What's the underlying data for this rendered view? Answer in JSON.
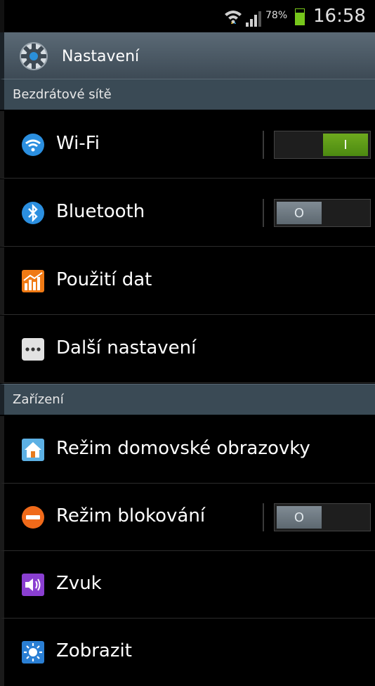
{
  "status_bar": {
    "battery_percent": "78%",
    "time": "16:58",
    "wifi_icon": "wifi-icon",
    "signal_icon": "signal-icon",
    "battery_level": 0.78
  },
  "header": {
    "title": "Nastavení",
    "icon": "gear-icon"
  },
  "sections": {
    "wireless": "Bezdrátové sítě",
    "device": "Zařízení"
  },
  "items": {
    "wifi": {
      "label": "Wi-Fi",
      "icon": "wifi-icon",
      "toggle": "on",
      "toggle_symbol": "I"
    },
    "bluetooth": {
      "label": "Bluetooth",
      "icon": "bluetooth-icon",
      "toggle": "off",
      "toggle_symbol": "O"
    },
    "data_usage": {
      "label": "Použití dat",
      "icon": "data-usage-icon"
    },
    "more_settings": {
      "label": "Další nastavení",
      "icon": "more-icon"
    },
    "home_screen_mode": {
      "label": "Režim domovské obrazovky",
      "icon": "home-icon"
    },
    "blocking_mode": {
      "label": "Režim blokování",
      "icon": "block-icon",
      "toggle": "off",
      "toggle_symbol": "O"
    },
    "sound": {
      "label": "Zvuk",
      "icon": "speaker-icon"
    },
    "display": {
      "label": "Zobrazit",
      "icon": "brightness-icon"
    }
  },
  "colors": {
    "toggle_on": "#5b9a17",
    "toggle_off": "#6e7a83",
    "header_bg": "#4b5964",
    "section_bg": "#3a4a55"
  }
}
